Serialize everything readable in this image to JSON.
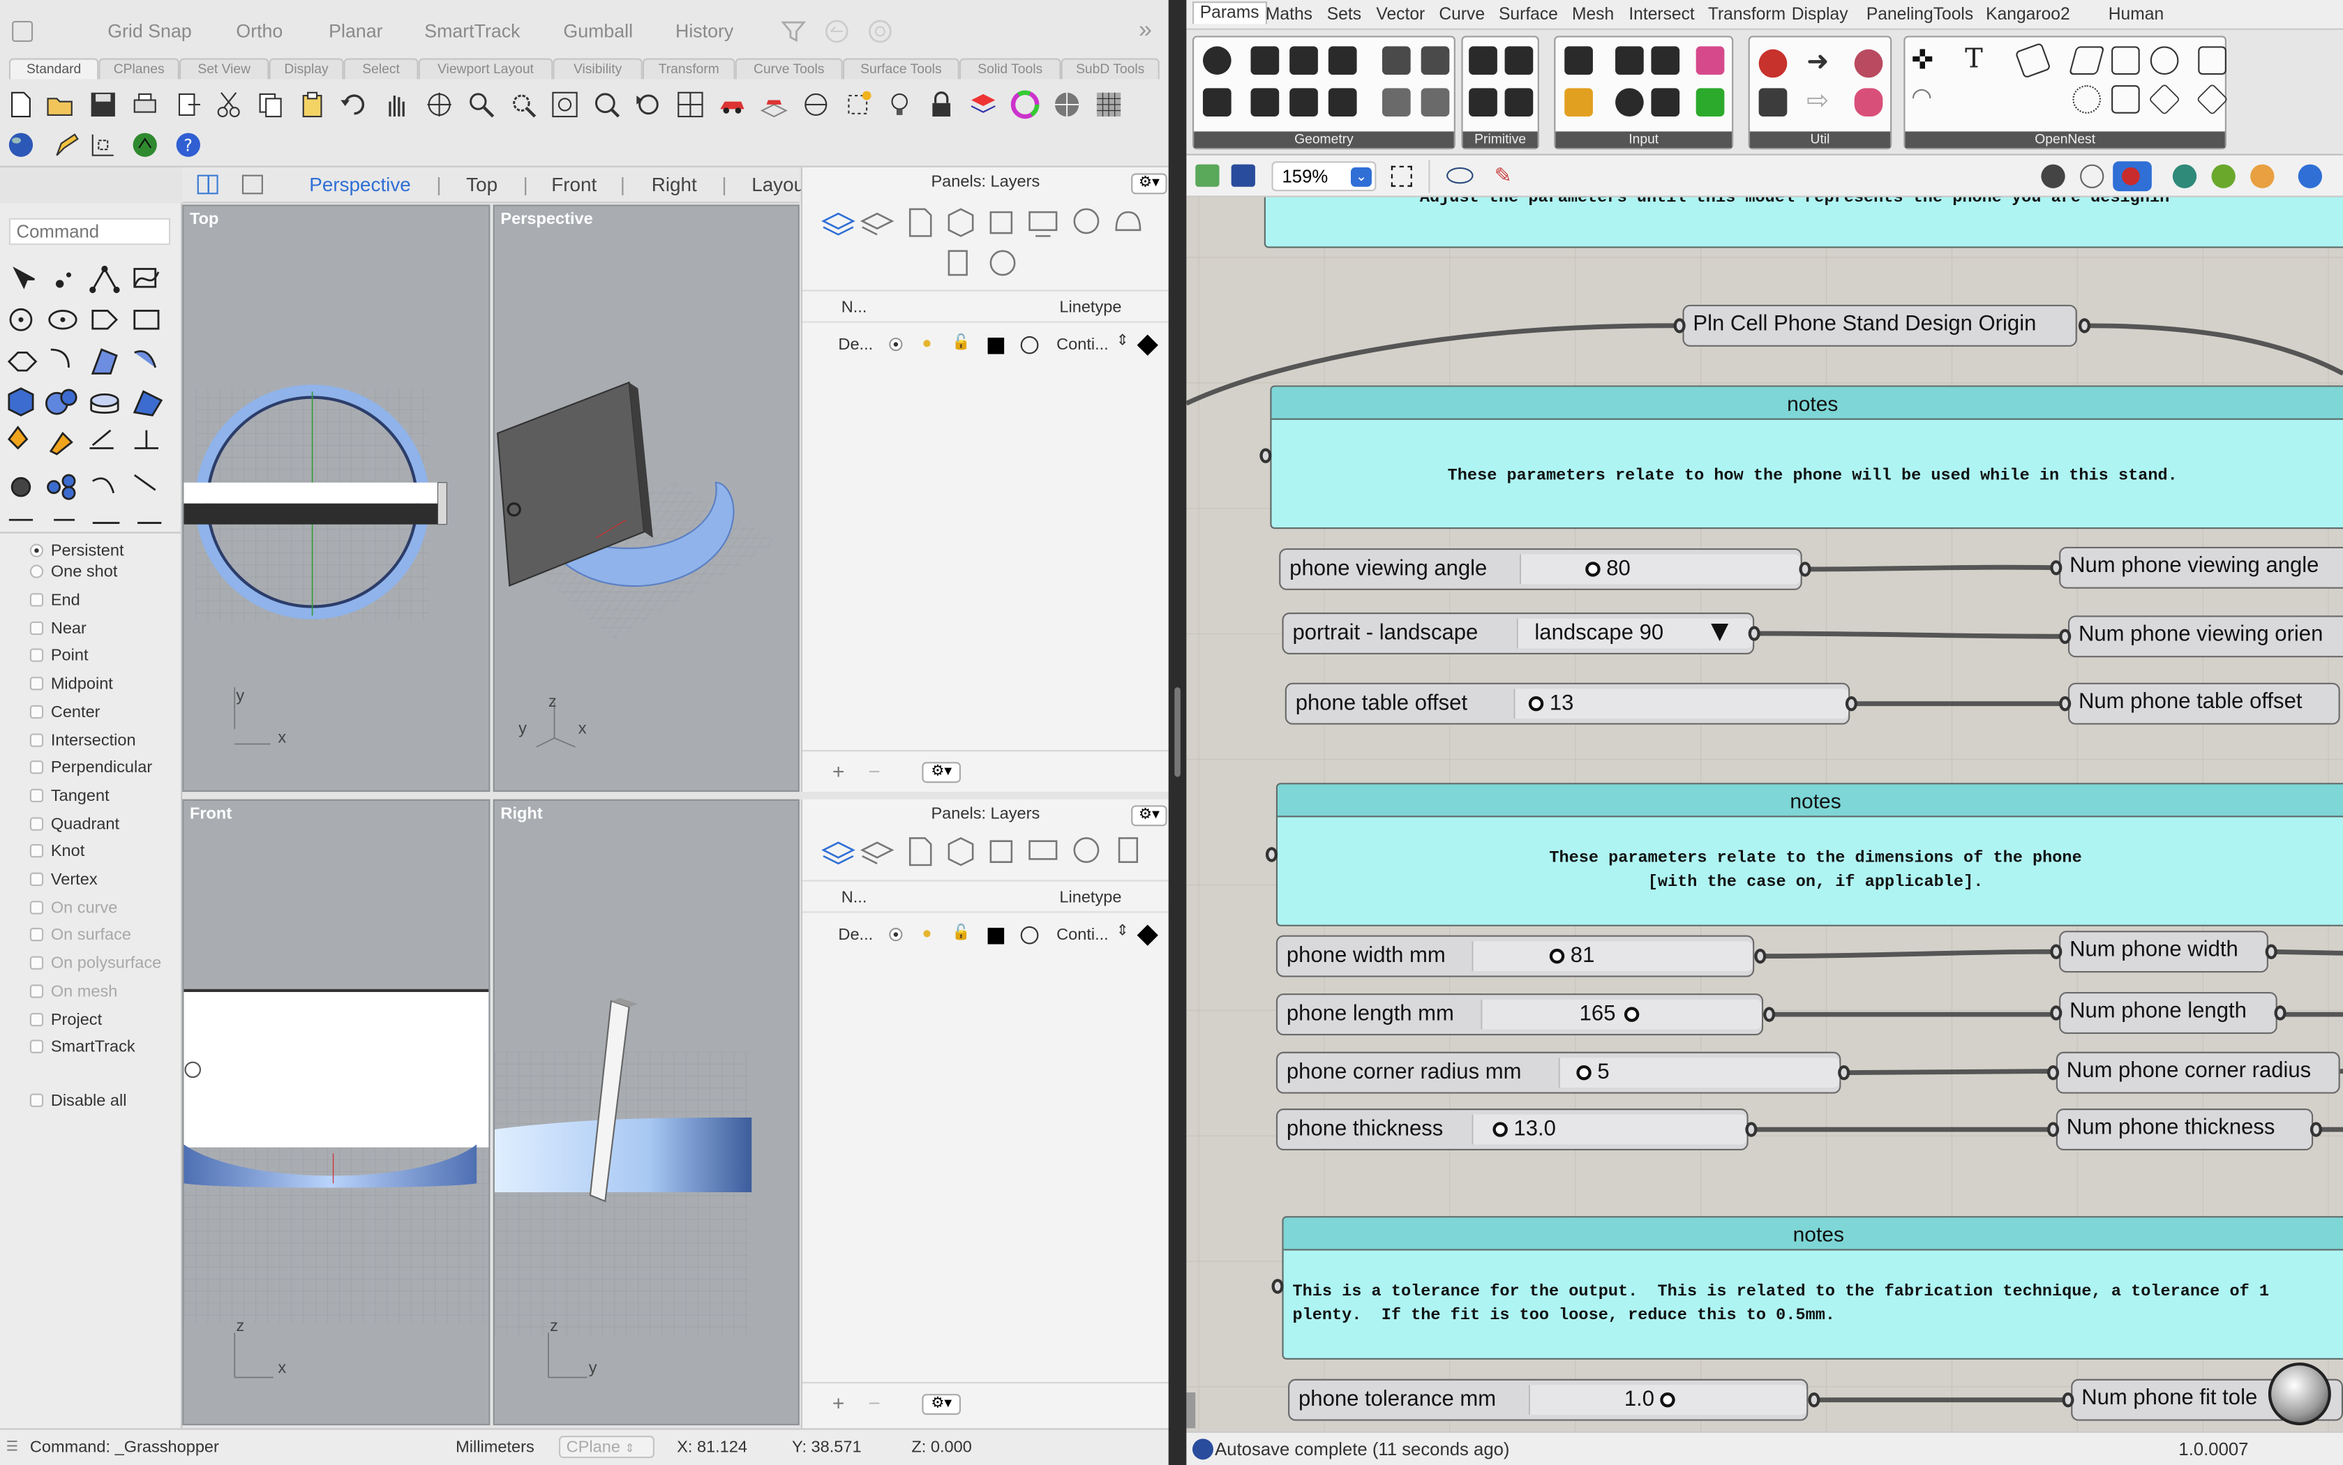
{
  "rhino": {
    "top_buttons": [
      "Grid Snap",
      "Ortho",
      "Planar",
      "SmartTrack",
      "Gumball",
      "History"
    ],
    "tabs": [
      "Standard",
      "CPlanes",
      "Set View",
      "Display",
      "Select",
      "Viewport Layout",
      "Visibility",
      "Transform",
      "Curve Tools",
      "Surface Tools",
      "Solid Tools",
      "SubD Tools"
    ],
    "command_placeholder": "Command",
    "viewport_tabs": [
      "Perspective",
      "Top",
      "Front",
      "Right",
      "Layou"
    ],
    "viewports": {
      "top": "Top",
      "perspective": "Perspective",
      "front": "Front",
      "right": "Right"
    },
    "axes": {
      "x": "x",
      "y": "y",
      "z": "z"
    },
    "osnap_mode": [
      "Persistent",
      "One shot"
    ],
    "osnaps": [
      "End",
      "Near",
      "Point",
      "Midpoint",
      "Center",
      "Intersection",
      "Perpendicular",
      "Tangent",
      "Quadrant",
      "Knot",
      "Vertex"
    ],
    "osnaps_disabled": [
      "On curve",
      "On surface",
      "On polysurface",
      "On mesh"
    ],
    "osnaps_extra": [
      "Project",
      "SmartTrack"
    ],
    "disable_all": "Disable all",
    "panel_title": "Panels: Layers",
    "layer_headers": {
      "name": "N...",
      "linetype": "Linetype"
    },
    "layer_row": {
      "name": "De...",
      "linetype": "Conti..."
    },
    "status": {
      "command": "Command: _Grasshopper",
      "units": "Millimeters",
      "cplane": "CPlane",
      "x": "X: 81.124",
      "y": "Y: 38.571",
      "z": "Z: 0.000"
    }
  },
  "gh": {
    "menu": [
      "Params",
      "Maths",
      "Sets",
      "Vector",
      "Curve",
      "Surface",
      "Mesh",
      "Intersect",
      "Transform",
      "Display",
      "PanelingTools",
      "Kangaroo2",
      "Human"
    ],
    "groups": [
      "Geometry",
      "Primitive",
      "Input",
      "Util",
      "OpenNest"
    ],
    "zoom": "159%",
    "top_note": "Adjust the parameters until this model represents the phone you are designin",
    "origin": "Pln Cell Phone Stand Design Origin",
    "note_title": "notes",
    "note1": "These parameters relate to how the phone will be used while in this stand.",
    "note2": "These parameters relate to the dimensions of the phone\n[with the case on, if applicable].",
    "note3": "This is a tolerance for the output.  This is related to the fabrication technique, a tolerance of 1\nplenty.  If the fit is too loose, reduce this to 0.5mm.",
    "sliders": [
      {
        "label": "phone viewing angle",
        "value": "80",
        "out": "Num phone viewing angle"
      },
      {
        "label": "portrait - landscape",
        "value": "landscape 90",
        "out": "Num phone viewing orien"
      },
      {
        "label": "phone table offset",
        "value": "13",
        "out": "Num phone table offset"
      },
      {
        "label": "phone width mm",
        "value": "81",
        "out": "Num phone width"
      },
      {
        "label": "phone length mm",
        "value": "165",
        "out": "Num phone length"
      },
      {
        "label": "phone corner radius mm",
        "value": "5",
        "out": "Num phone corner radius"
      },
      {
        "label": "phone thickness",
        "value": "13.0",
        "out": "Num phone thickness"
      },
      {
        "label": "phone tolerance mm",
        "value": "1.0",
        "out": "Num phone fit tole"
      }
    ],
    "status": "Autosave complete (11 seconds ago)",
    "version": "1.0.0007"
  }
}
